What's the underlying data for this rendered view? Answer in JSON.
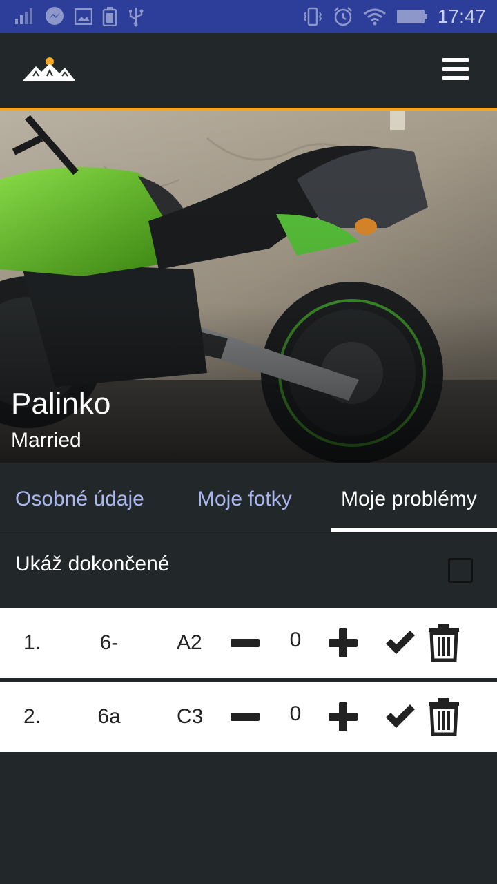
{
  "status_bar": {
    "time": "17:47",
    "left_icons": [
      "signal-icon",
      "messenger-icon",
      "gallery-icon",
      "battery-saver-icon",
      "usb-icon"
    ],
    "right_icons": [
      "vibrate-icon",
      "alarm-icon",
      "wifi-icon",
      "battery-icon"
    ]
  },
  "app_bar": {
    "logo_icon": "mountain-logo-icon",
    "menu_icon": "hamburger-menu-icon"
  },
  "colors": {
    "status_bar": "#2c3e99",
    "background": "#22282a",
    "accent": "#f5a623",
    "tab_inactive": "#aab6f0"
  },
  "profile": {
    "name": "Palinko",
    "status": "Married"
  },
  "tabs": [
    {
      "label": "Osobné údaje",
      "active": false
    },
    {
      "label": "Moje fotky",
      "active": false
    },
    {
      "label": "Moje problémy",
      "active": true
    }
  ],
  "filter": {
    "label": "Ukáž dokončené",
    "checked": false
  },
  "problems": [
    {
      "index": "1.",
      "grade": "6-",
      "sector": "A2",
      "count": "0"
    },
    {
      "index": "2.",
      "grade": "6a",
      "sector": "C3",
      "count": "0"
    }
  ]
}
